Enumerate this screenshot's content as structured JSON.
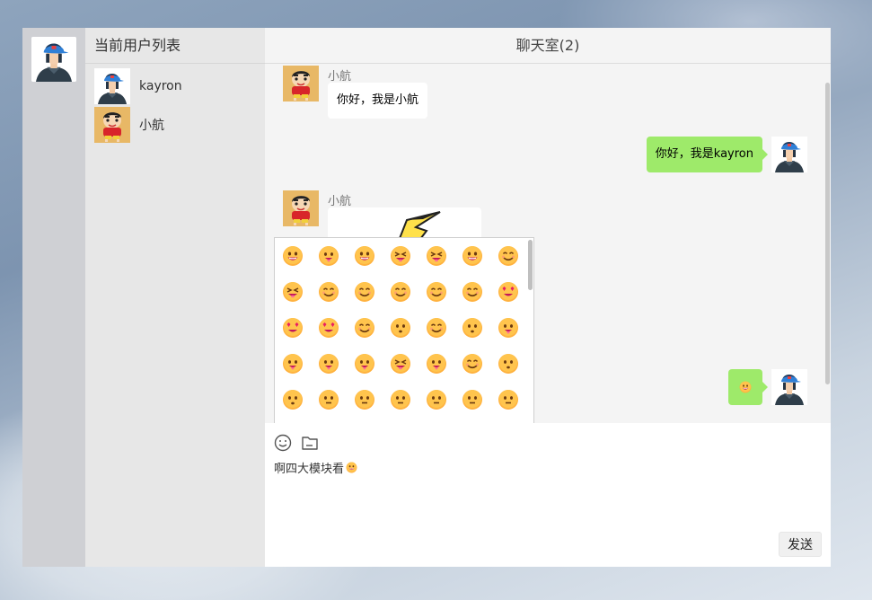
{
  "sidebar_rail": {
    "avatar_icon": "user-blue-cap-avatar"
  },
  "users_panel": {
    "title": "当前用户列表",
    "users": [
      {
        "name": "kayron",
        "avatar_icon": "user-blue-cap-avatar"
      },
      {
        "name": "小航",
        "avatar_icon": "crayon-shin-chan-avatar"
      }
    ]
  },
  "chat": {
    "title": "聊天室(2)",
    "messages": [
      {
        "side": "left",
        "sender": "小航",
        "text": "你好，我是小航",
        "avatar_icon": "crayon-shin-chan-avatar"
      },
      {
        "side": "right",
        "text": "你好，我是kayron",
        "avatar_icon": "user-blue-cap-avatar"
      },
      {
        "side": "left",
        "sender": "小航",
        "content_type": "image",
        "image_icon": "pikachu-ear-sticker",
        "avatar_icon": "crayon-shin-chan-avatar"
      },
      {
        "side": "right",
        "content_type": "emoji",
        "emoji_icon": "smiling-face-emoji",
        "avatar_icon": "user-blue-cap-avatar"
      }
    ]
  },
  "emoji_panel": {
    "emojis": [
      "grinning-face",
      "grinning-big-eyes",
      "grinning-smiling-eyes",
      "beaming-face",
      "squinting-laughing",
      "grinning-sweat",
      "rolling-laughing",
      "tears-of-joy",
      "slightly-smiling",
      "upside-down-face",
      "winking-face",
      "smiling-eyes",
      "halo-face",
      "hearts-face",
      "heart-eyes",
      "star-struck",
      "blowing-kiss",
      "kissing-face",
      "kissing-closed-eyes",
      "kissing-smiling-eyes",
      "savoring-food",
      "tongue-out",
      "winking-tongue",
      "zany-face",
      "squinting-tongue",
      "money-mouth",
      "hugging-face",
      "hand-over-mouth",
      "shushing-face",
      "thinking-face",
      "zipper-mouth",
      "raised-eyebrow",
      "neutral-face",
      "expressionless",
      "no-mouth"
    ]
  },
  "composer": {
    "text": "啊四大模块看",
    "inline_emoji_icon": "grinning-emoji",
    "emoji_tool_icon": "smiley-outline-icon",
    "file_tool_icon": "folder-icon",
    "send_label": "发送"
  },
  "colors": {
    "self_bubble": "#9eea6a",
    "other_bubble": "#ffffff",
    "emoji_yellow": "#ffb23f"
  }
}
